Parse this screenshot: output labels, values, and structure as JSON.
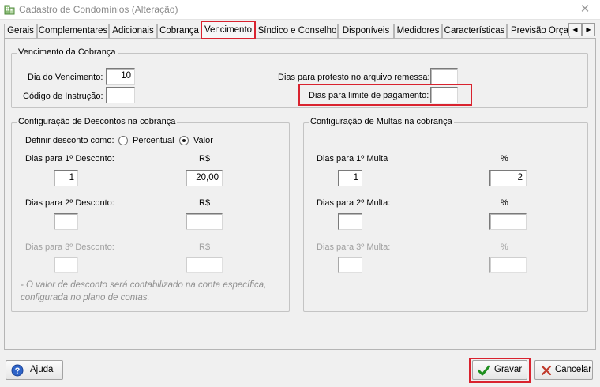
{
  "window": {
    "title": "Cadastro de Condomínios (Alteração)",
    "close_glyph": "✕"
  },
  "tabs": [
    {
      "label": "Gerais",
      "active": false
    },
    {
      "label": "Complementares",
      "active": false
    },
    {
      "label": "Adicionais",
      "active": false
    },
    {
      "label": "Cobrança",
      "active": false
    },
    {
      "label": "Vencimento",
      "active": true
    },
    {
      "label": "Síndico e Conselho",
      "active": false
    },
    {
      "label": "Disponíveis",
      "active": false
    },
    {
      "label": "Medidores",
      "active": false
    },
    {
      "label": "Características",
      "active": false
    },
    {
      "label": "Previsão Orçam",
      "active": false
    }
  ],
  "tab_scroll": {
    "left": "◀",
    "right": "▶"
  },
  "vencimento": {
    "legend": "Vencimento da  Cobrança",
    "dia_label": "Dia do Vencimento:",
    "dia_value": "10",
    "codigo_label": "Código de Instrução:",
    "codigo_value": "",
    "protesto_label": "Dias para protesto no arquivo remessa:",
    "protesto_value": "",
    "limite_label": "Dias para limite de pagamento:",
    "limite_value": ""
  },
  "descontos": {
    "legend": "Configuração de Descontos na cobrança",
    "definir_label": "Definir desconto como:",
    "option_percentual": "Percentual",
    "option_valor": "Valor",
    "selected": "Valor",
    "rows": [
      {
        "label": "Dias para 1º Desconto:",
        "unit": "R$",
        "days": "1",
        "amount": "20,00",
        "enabled": true
      },
      {
        "label": "Dias para 2º Desconto:",
        "unit": "R$",
        "days": "",
        "amount": "",
        "enabled": true
      },
      {
        "label": "Dias para 3º Desconto:",
        "unit": "R$",
        "days": "",
        "amount": "",
        "enabled": false
      }
    ],
    "note_line1": "- O valor de desconto será contabilizado na conta específica,",
    "note_line2": "configurada no plano de contas."
  },
  "multas": {
    "legend": "Configuração de Multas na cobrança",
    "rows": [
      {
        "label": "Dias para 1º Multa",
        "unit": "%",
        "days": "1",
        "amount": "2",
        "enabled": true
      },
      {
        "label": "Dias para 2º Multa:",
        "unit": "%",
        "days": "",
        "amount": "",
        "enabled": true
      },
      {
        "label": "Dias para 3º Multa:",
        "unit": "%",
        "days": "",
        "amount": "",
        "enabled": false
      }
    ]
  },
  "buttons": {
    "help": "Ajuda",
    "save": "Gravar",
    "cancel": "Cancelar"
  },
  "colors": {
    "highlight": "#d9232f",
    "save_check": "#1f8f1f",
    "cancel_x": "#c0392b",
    "help_icon": "#2e64c8"
  }
}
